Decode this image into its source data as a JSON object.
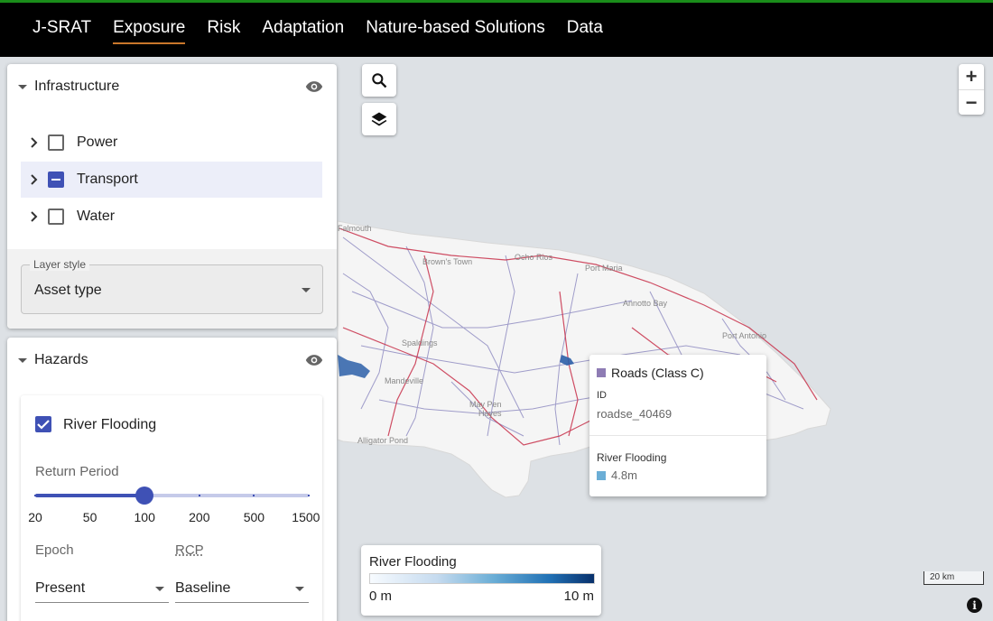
{
  "nav": {
    "items": [
      {
        "label": "J-SRAT"
      },
      {
        "label": "Exposure"
      },
      {
        "label": "Risk"
      },
      {
        "label": "Adaptation"
      },
      {
        "label": "Nature-based Solutions"
      },
      {
        "label": "Data"
      }
    ],
    "active": "Exposure"
  },
  "infrastructure": {
    "title": "Infrastructure",
    "items": [
      {
        "label": "Power",
        "state": "unchecked"
      },
      {
        "label": "Transport",
        "state": "indeterminate"
      },
      {
        "label": "Water",
        "state": "unchecked"
      }
    ],
    "layer_style": {
      "label": "Layer style",
      "value": "Asset type"
    }
  },
  "hazards": {
    "title": "Hazards",
    "river_flooding": {
      "label": "River Flooding",
      "checked": true,
      "return_period_label": "Return Period",
      "return_periods": [
        "20",
        "50",
        "100",
        "200",
        "500",
        "1500"
      ],
      "selected_return_period": "100",
      "epoch_label": "Epoch",
      "epoch_value": "Present",
      "rcp_label": "RCP",
      "rcp_value": "Baseline"
    }
  },
  "map": {
    "place_names": [
      "Falmouth",
      "Brown's Town",
      "Ocho Rios",
      "Port Maria",
      "Annotto Bay",
      "Spaldings",
      "Mandeville",
      "May Pen",
      "Port Antonio",
      "Alligator Pond",
      "Hayes"
    ],
    "popup": {
      "title": "Roads (Class C)",
      "title_color": "#8e7cb4",
      "id_label": "ID",
      "id_value": "roadse_40469",
      "hazard_label": "River Flooding",
      "hazard_value": "4.8m",
      "hazard_color": "#6baed6"
    },
    "legend": {
      "title": "River Flooding",
      "min": "0 m",
      "max": "10 m"
    },
    "scale": "20 km",
    "zoom_in": "+",
    "zoom_out": "−",
    "info": "i"
  }
}
